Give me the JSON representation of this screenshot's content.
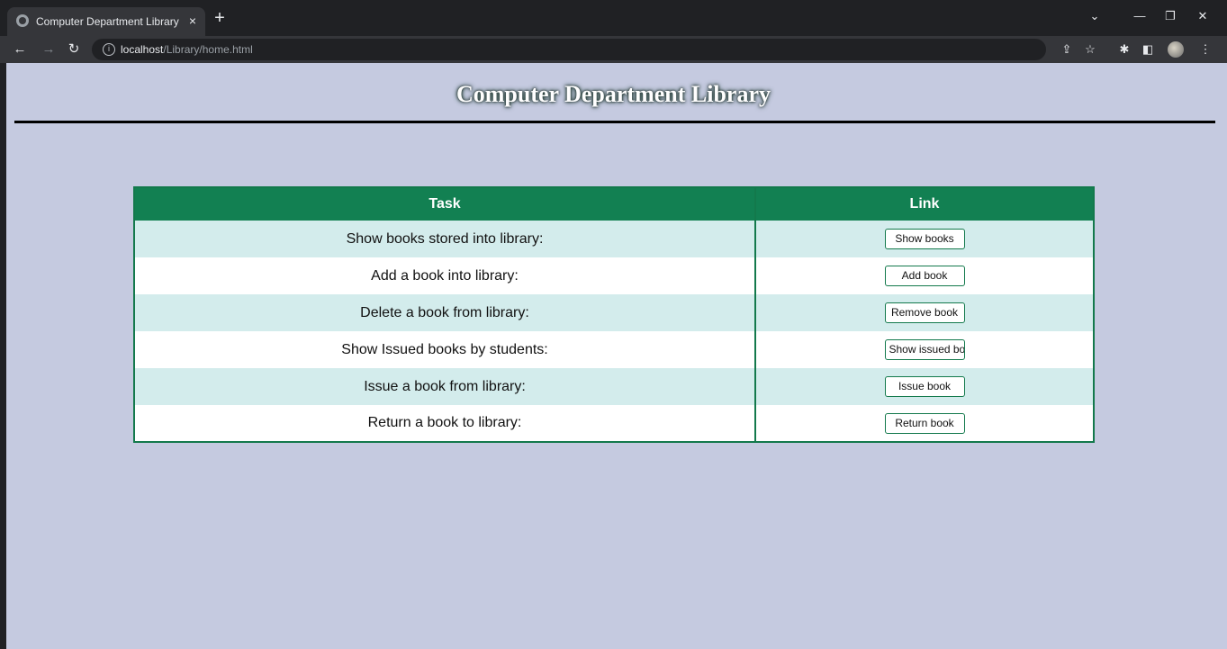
{
  "browser": {
    "tab_title": "Computer Department Library",
    "tab_close": "×",
    "new_tab": "+",
    "url_host": "localhost",
    "url_path": "/Library/home.html",
    "window_controls": {
      "chevron": "⌄",
      "minimize": "—",
      "restore": "❐",
      "close": "✕"
    }
  },
  "page": {
    "title": "Computer Department Library",
    "table": {
      "headers": {
        "task": "Task",
        "link": "Link"
      },
      "rows": [
        {
          "task": "Show books stored into library:",
          "button": "Show books"
        },
        {
          "task": "Add a book into library:",
          "button": "Add book"
        },
        {
          "task": "Delete a book from library:",
          "button": "Remove book"
        },
        {
          "task": "Show Issued books by students:",
          "button": "Show issued books"
        },
        {
          "task": "Issue a book from library:",
          "button": "Issue book"
        },
        {
          "task": "Return a book to library:",
          "button": "Return book"
        }
      ]
    }
  },
  "colors": {
    "page_bg": "#c5cae0",
    "table_header": "#128052",
    "row_alt": "#d3ecec",
    "border": "#13794c"
  }
}
